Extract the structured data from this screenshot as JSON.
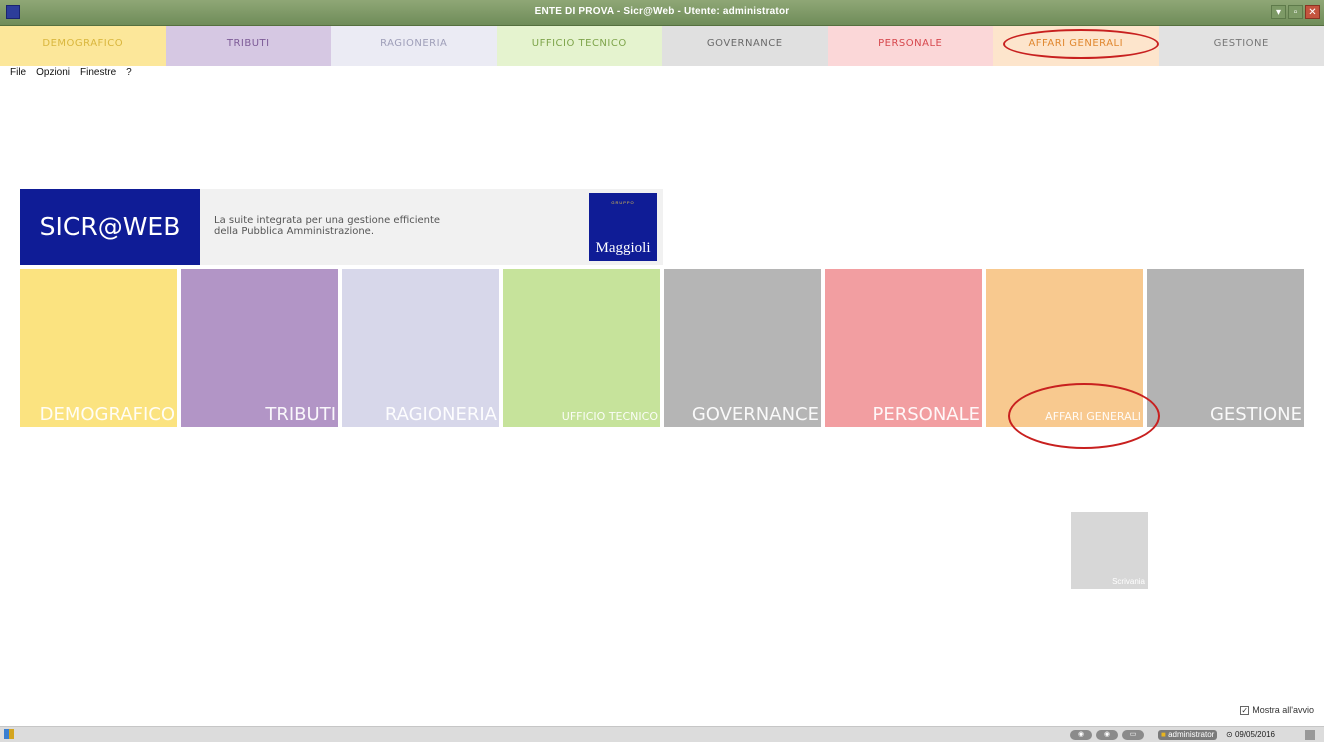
{
  "window": {
    "title": "ENTE DI PROVA - Sicr@Web - Utente: administrator",
    "controls": [
      "minimize-icon",
      "maximize-icon",
      "close-icon"
    ]
  },
  "tabs": [
    {
      "label": "DEMOGRAFICO",
      "bg": "#fce79a",
      "fg": "#d9b63d"
    },
    {
      "label": "TRIBUTI",
      "bg": "#d6c8e3",
      "fg": "#7d5b97"
    },
    {
      "label": "RAGIONERIA",
      "bg": "#ebebf4",
      "fg": "#9e9eb8"
    },
    {
      "label": "UFFICIO TECNICO",
      "bg": "#e5f3cf",
      "fg": "#7ea44b"
    },
    {
      "label": "GOVERNANCE",
      "bg": "#e0e0e0",
      "fg": "#6a6a6a"
    },
    {
      "label": "PERSONALE",
      "bg": "#fbd7d8",
      "fg": "#d6474d"
    },
    {
      "label": "AFFARI GENERALI",
      "bg": "#fde5cc",
      "fg": "#e0872f"
    },
    {
      "label": "GESTIONE",
      "bg": "#e2e2e2",
      "fg": "#777777"
    }
  ],
  "menu": [
    "File",
    "Opzioni",
    "Finestre",
    "?"
  ],
  "banner": {
    "brand": "SICR@WEB",
    "tagline_1": "La suite integrata per una gestione efficiente",
    "tagline_2": "della Pubblica Amministrazione.",
    "logo_group": "GRUPPO",
    "logo_name": "Maggioli"
  },
  "tiles": [
    {
      "label": "DEMOGRAFICO",
      "color": "#fbe380"
    },
    {
      "label": "TRIBUTI",
      "color": "#b295c6"
    },
    {
      "label": "RAGIONERIA",
      "color": "#d7d7ea"
    },
    {
      "label": "UFFICIO TECNICO",
      "color": "#c6e39b"
    },
    {
      "label": "GOVERNANCE",
      "color": "#b5b5b5"
    },
    {
      "label": "PERSONALE",
      "color": "#f29ea1"
    },
    {
      "label": "AFFARI GENERALI",
      "color": "#f8c98f"
    },
    {
      "label": "GESTIONE",
      "color": "#b3b3b3"
    }
  ],
  "scrivania": {
    "label": "Scrivania"
  },
  "startup": {
    "label": "Mostra all'avvio",
    "checked": true
  },
  "status": {
    "user": "administrator",
    "date": "09/05/2016"
  },
  "colors": {
    "annotation": "#c8201f",
    "brand_blue": "#0f1c96",
    "titlebar": "#7d9a66"
  }
}
